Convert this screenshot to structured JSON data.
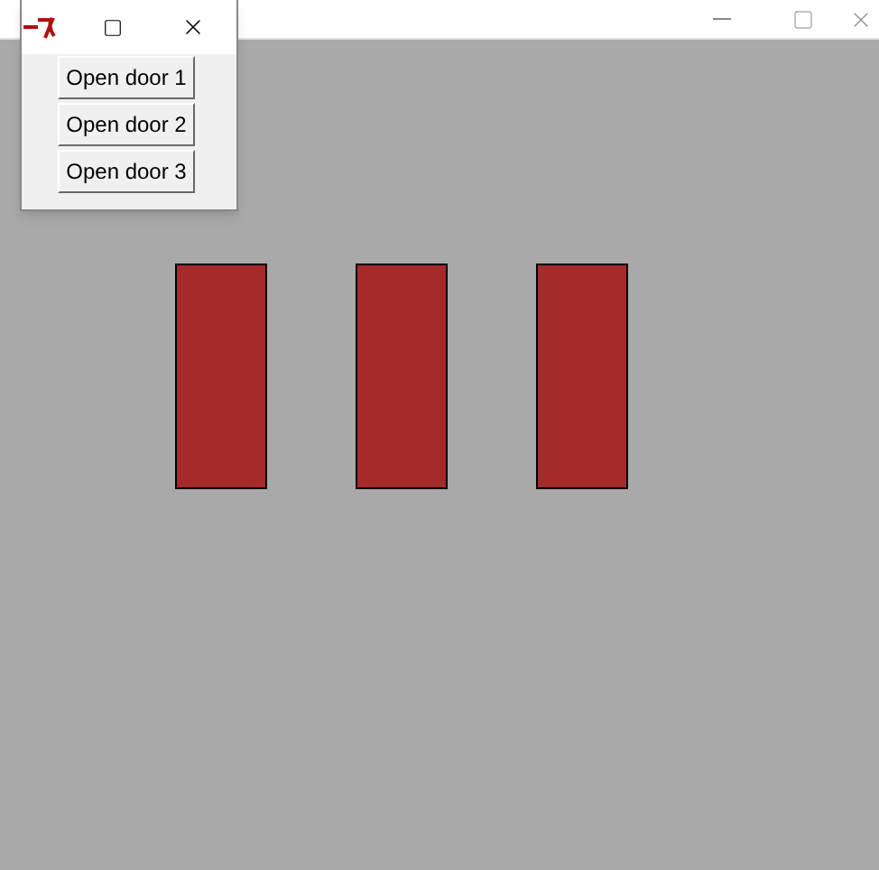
{
  "dialog": {
    "buttons": [
      {
        "label": "Open door 1"
      },
      {
        "label": "Open door 2"
      },
      {
        "label": "Open door 3"
      }
    ]
  },
  "doors": [
    {
      "open": false
    },
    {
      "open": false
    },
    {
      "open": false
    }
  ]
}
